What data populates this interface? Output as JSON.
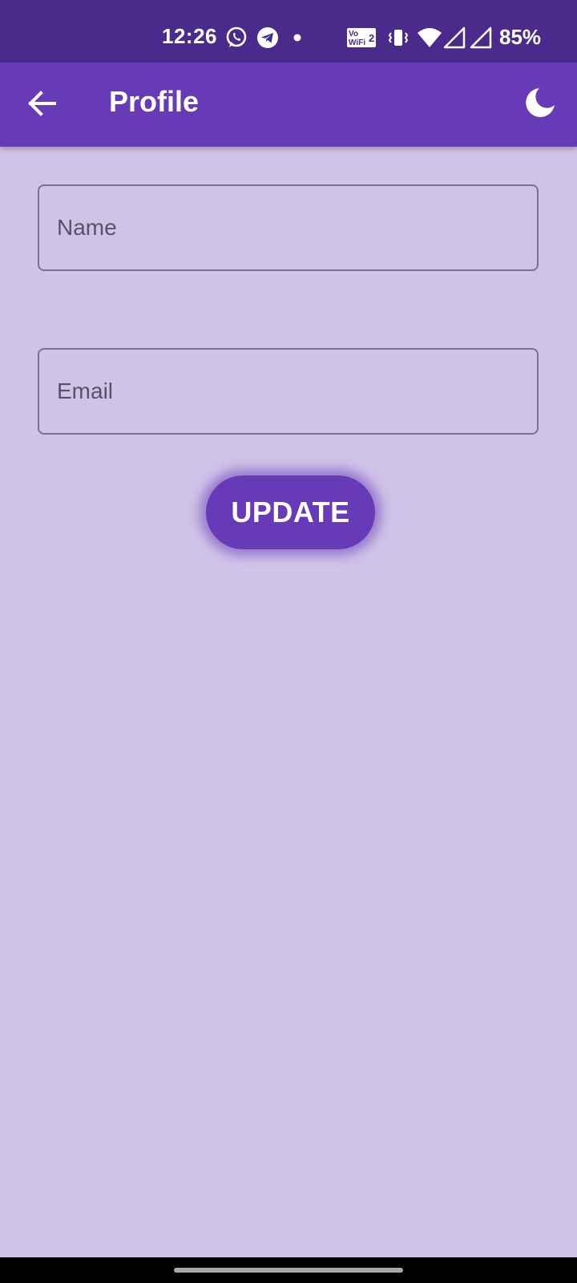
{
  "status_bar": {
    "time": "12:26",
    "battery": "85%",
    "wifi_badge_top": "Vo",
    "wifi_badge_bottom": "WiFi",
    "wifi_badge_num": "2",
    "icons": [
      "whatsapp-icon",
      "telegram-icon",
      "dot-icon",
      "vowifi-icon",
      "vibrate-icon",
      "wifi-icon",
      "signal-icon",
      "signal-icon"
    ]
  },
  "app_bar": {
    "title": "Profile",
    "back_icon": "arrow-left-icon",
    "theme_icon": "moon-icon",
    "color": "#673ab7"
  },
  "form": {
    "name_placeholder": "Name",
    "name_value": "",
    "email_placeholder": "Email",
    "email_value": "",
    "update_label": "UPDATE"
  },
  "colors": {
    "status_bar": "#4a2a8a",
    "background": "#d0c3e8",
    "accent": "#673ab7"
  }
}
